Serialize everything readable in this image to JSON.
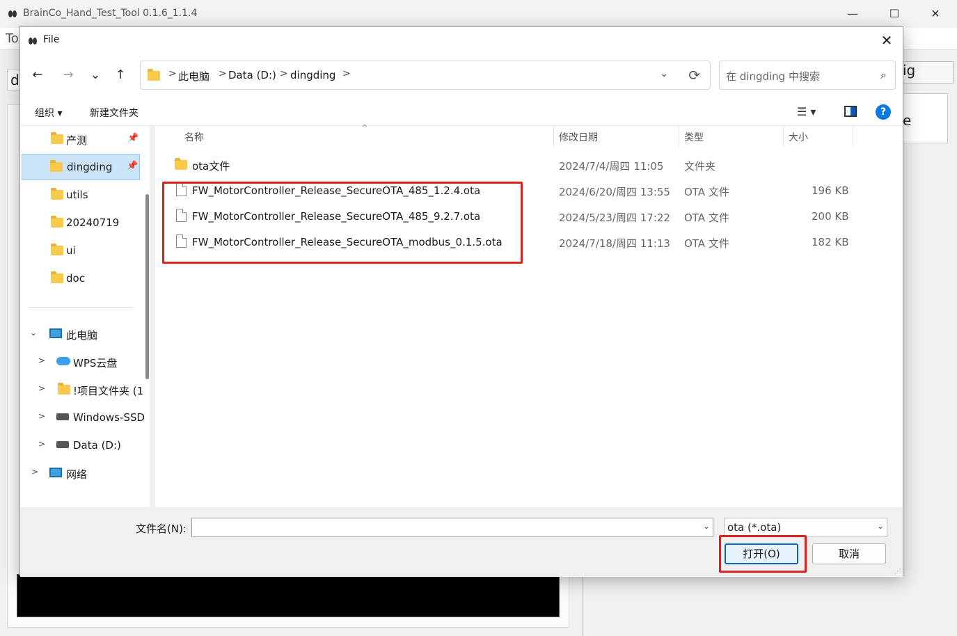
{
  "background_app": {
    "title": "BrainCo_Hand_Test_Tool   0.1.6_1.1.4",
    "minimize_label": "—",
    "maximize_label": "☐",
    "close_label": "✕",
    "menu_partial": "To",
    "left_partial": "d",
    "tab_partial": "ig",
    "box_partial": "e"
  },
  "dialog": {
    "title": "File",
    "close_label": "✕",
    "nav": {
      "back_label": "←",
      "forward_label": "→",
      "recent_label": "⌄",
      "up_label": "↑"
    },
    "address": {
      "crumbs": [
        "此电脑",
        "Data (D:)",
        "dingding"
      ],
      "separator": ">",
      "dropdown_label": "⌄",
      "refresh_label": "⟳"
    },
    "search": {
      "placeholder": "在 dingding 中搜索",
      "icon_label": "⌕"
    },
    "toolbar": {
      "organize_label": "组织 ▾",
      "new_folder_label": "新建文件夹",
      "view_label": "☰  ▾",
      "help_label": "?"
    },
    "nav_pane": {
      "quick_items": [
        {
          "label": "产测",
          "pinned": true
        },
        {
          "label": "dingding",
          "pinned": true,
          "selected": true
        },
        {
          "label": "utils"
        },
        {
          "label": "20240719"
        },
        {
          "label": "ui"
        },
        {
          "label": "doc"
        }
      ],
      "pin_glyph": "📌",
      "tree": [
        {
          "label": "此电脑",
          "expanded": true,
          "chevron": "⌄"
        },
        {
          "label": "WPS云盘",
          "chevron": ">"
        },
        {
          "label": "!项目文件夹 (1",
          "chevron": ">"
        },
        {
          "label": "Windows-SSD",
          "chevron": ">"
        },
        {
          "label": "Data (D:)",
          "chevron": ">"
        },
        {
          "label": "网络",
          "chevron": ">"
        }
      ]
    },
    "columns": {
      "name": "名称",
      "modified": "修改日期",
      "type": "类型",
      "size": "大小",
      "sort_glyph": "^"
    },
    "files": [
      {
        "name": "ota文件",
        "modified": "2024/7/4/周四 11:05",
        "type": "文件夹",
        "size": "",
        "kind": "folder"
      },
      {
        "name": "FW_MotorController_Release_SecureOTA_485_1.2.4.ota",
        "modified": "2024/6/20/周四 13:55",
        "type": "OTA 文件",
        "size": "196 KB",
        "kind": "file"
      },
      {
        "name": "FW_MotorController_Release_SecureOTA_485_9.2.7.ota",
        "modified": "2024/5/23/周四 17:22",
        "type": "OTA 文件",
        "size": "200 KB",
        "kind": "file"
      },
      {
        "name": "FW_MotorController_Release_SecureOTA_modbus_0.1.5.ota",
        "modified": "2024/7/18/周四 11:13",
        "type": "OTA 文件",
        "size": "182 KB",
        "kind": "file"
      }
    ],
    "footer": {
      "filename_label": "文件名(N):",
      "filename_value": "",
      "filetype_value": "ota (*.ota)",
      "dropdown_glyph": "⌄",
      "open_label": "打开(O)",
      "cancel_label": "取消"
    },
    "colors": {
      "highlight": "#e0201e",
      "selection": "#cce4f7",
      "accent": "#0a64c8"
    }
  }
}
